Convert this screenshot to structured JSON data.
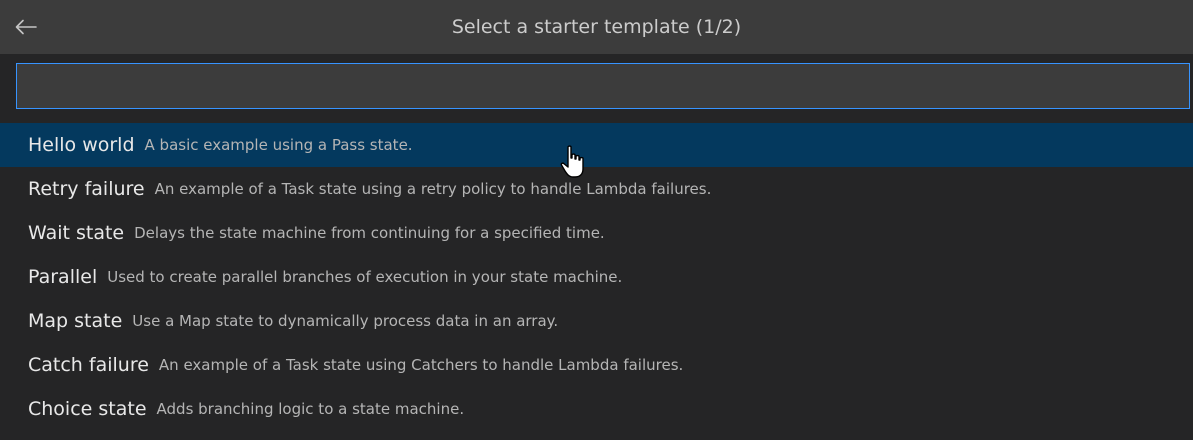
{
  "header": {
    "title": "Select a starter template (1/2)",
    "back_icon": "arrow-left-icon"
  },
  "search": {
    "value": "",
    "placeholder": ""
  },
  "items": [
    {
      "label": "Hello world",
      "description": "A basic example using a Pass state.",
      "selected": true
    },
    {
      "label": "Retry failure",
      "description": "An example of a Task state using a retry policy to handle Lambda failures.",
      "selected": false
    },
    {
      "label": "Wait state",
      "description": "Delays the state machine from continuing for a specified time.",
      "selected": false
    },
    {
      "label": "Parallel",
      "description": "Used to create parallel branches of execution in your state machine.",
      "selected": false
    },
    {
      "label": "Map state",
      "description": "Use a Map state to dynamically process data in an array.",
      "selected": false
    },
    {
      "label": "Catch failure",
      "description": "An example of a Task state using Catchers to handle Lambda failures.",
      "selected": false
    },
    {
      "label": "Choice state",
      "description": "Adds branching logic to a state machine.",
      "selected": false
    }
  ],
  "colors": {
    "background": "#252526",
    "titlebar": "#3c3c3c",
    "selected_row": "#04395e",
    "focus_border": "#3794ff"
  }
}
